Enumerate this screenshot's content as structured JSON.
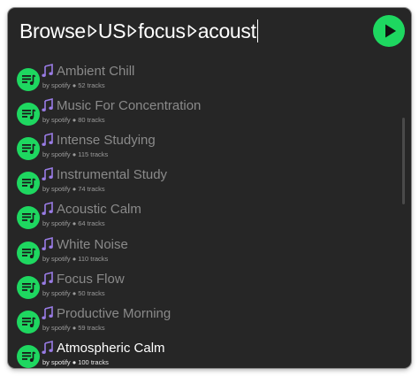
{
  "query": {
    "segments": [
      "Browse",
      "US",
      "focus",
      "acoust"
    ]
  },
  "play_button": {
    "icon": "play-icon",
    "color": "#1ed760"
  },
  "results": [
    {
      "title": "Ambient Chill",
      "author": "by spotify",
      "tracks": "52 tracks"
    },
    {
      "title": "Music For Concentration",
      "author": "by spotify",
      "tracks": "80 tracks"
    },
    {
      "title": "Intense Studying",
      "author": "by spotify",
      "tracks": "115 tracks"
    },
    {
      "title": "Instrumental Study",
      "author": "by spotify",
      "tracks": "74 tracks"
    },
    {
      "title": "Acoustic Calm",
      "author": "by spotify",
      "tracks": "64 tracks"
    },
    {
      "title": "White Noise",
      "author": "by spotify",
      "tracks": "110 tracks"
    },
    {
      "title": "Focus Flow",
      "author": "by spotify",
      "tracks": "50 tracks"
    },
    {
      "title": "Productive Morning",
      "author": "by spotify",
      "tracks": "59 tracks"
    },
    {
      "title": "Atmospheric Calm",
      "author": "by spotify",
      "tracks": "100 tracks",
      "selected": true
    }
  ],
  "colors": {
    "accent": "#1ed760",
    "note": "#9a7ce6",
    "background": "#262626"
  }
}
